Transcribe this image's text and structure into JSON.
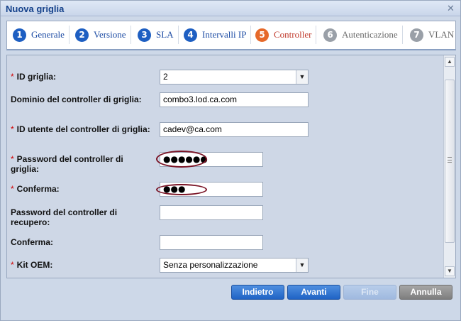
{
  "window": {
    "title": "Nuova griglia",
    "close_glyph": "✕"
  },
  "steps": [
    {
      "num": "1",
      "label": "Generale",
      "state": "done"
    },
    {
      "num": "2",
      "label": "Versione",
      "state": "done"
    },
    {
      "num": "3",
      "label": "SLA",
      "state": "done"
    },
    {
      "num": "4",
      "label": "Intervalli IP",
      "state": "done"
    },
    {
      "num": "5",
      "label": "Controller",
      "state": "active"
    },
    {
      "num": "6",
      "label": "Autenticazione",
      "state": "disabled"
    },
    {
      "num": "7",
      "label": "VLAN",
      "state": "disabled"
    }
  ],
  "form": {
    "id_griglia": {
      "label": "ID griglia:",
      "value": "2"
    },
    "dominio": {
      "label": "Dominio del controller di griglia:",
      "value": "combo3.lod.ca.com"
    },
    "id_utente": {
      "label": "ID utente del controller di griglia:",
      "value": "cadev@ca.com"
    },
    "password": {
      "label": "Password del controller di griglia:",
      "value": "●●●●●●"
    },
    "conferma": {
      "label": "Conferma:",
      "value": "●●●"
    },
    "password_recupero": {
      "label": "Password del controller di recupero:",
      "value": ""
    },
    "conferma_recupero": {
      "label": "Conferma:",
      "value": ""
    },
    "kit_oem": {
      "label": "Kit OEM:",
      "value": "Senza personalizzazione"
    },
    "required_mark": "*"
  },
  "buttons": {
    "back": "Indietro",
    "next": "Avanti",
    "finish": "Fine",
    "cancel": "Annulla"
  },
  "colors": {
    "active_step": "#e6692a",
    "step": "#1e5fc2",
    "disabled_step": "#9aa0a8",
    "required": "#d00000",
    "highlight": "#7a1325"
  }
}
